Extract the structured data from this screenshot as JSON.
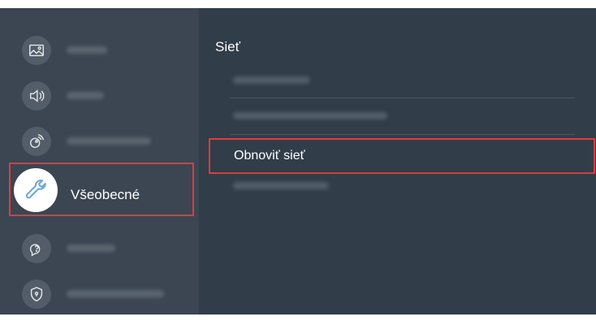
{
  "sidebar": {
    "selected_label": "Všeobecné",
    "items": [
      {
        "icon": "picture-icon"
      },
      {
        "icon": "sound-icon"
      },
      {
        "icon": "broadcasting-icon"
      },
      {
        "icon": "general-wrench-icon",
        "label": "Všeobecné",
        "selected": true
      },
      {
        "icon": "support-icon"
      },
      {
        "icon": "privacy-shield-icon"
      }
    ]
  },
  "panel": {
    "title": "Sieť",
    "selected_item": "Obnoviť sieť"
  },
  "colors": {
    "background": "#313d49",
    "sidebar": "#3b4652",
    "highlight_border": "#e03b3b"
  }
}
